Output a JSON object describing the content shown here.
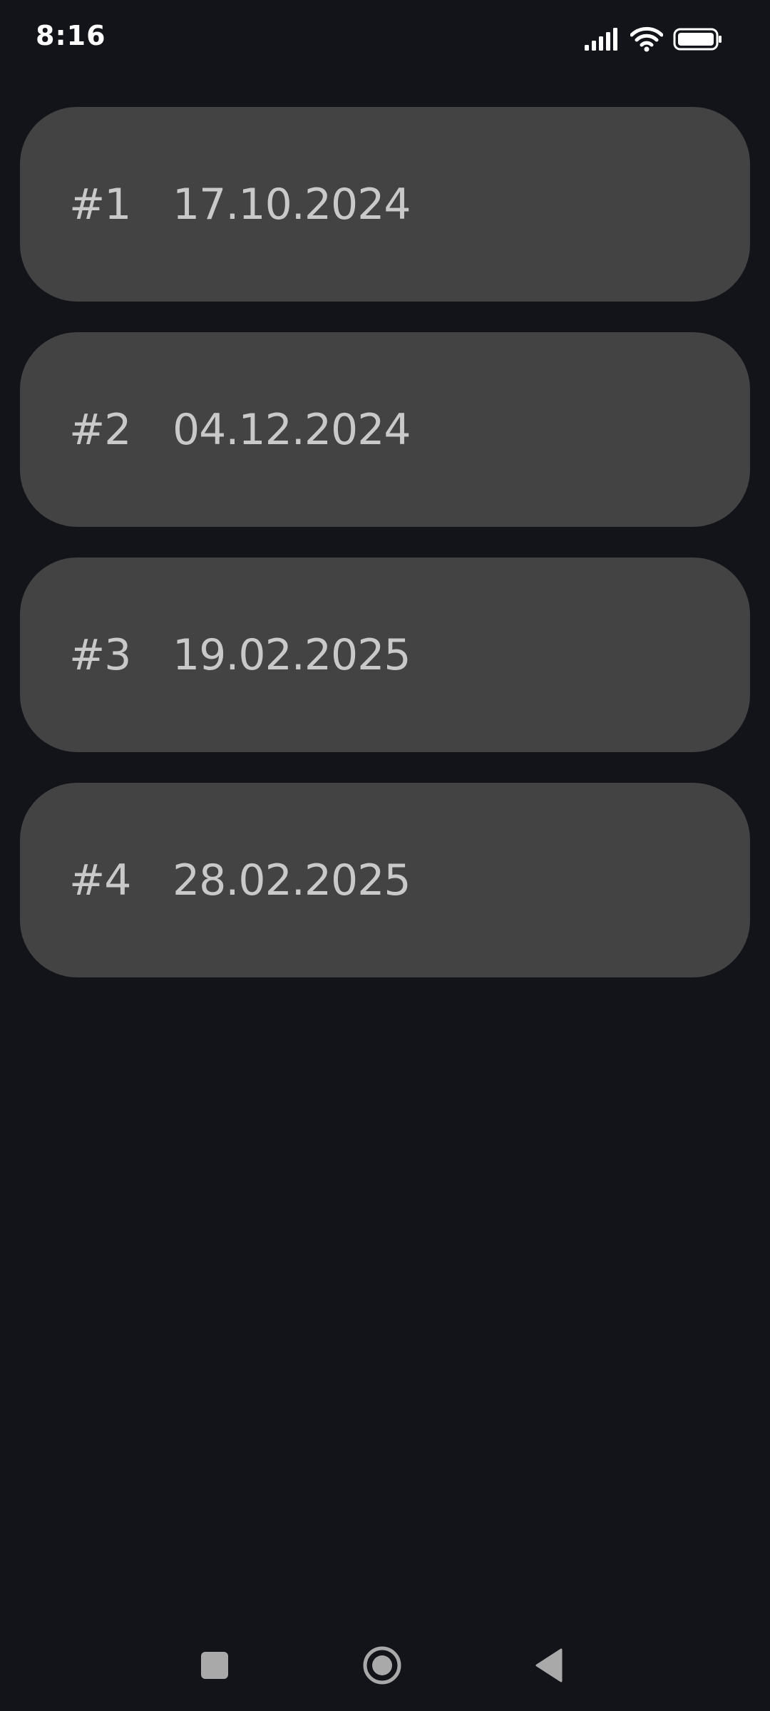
{
  "status_bar": {
    "time": "8:16",
    "icons": [
      "signal-icon",
      "wifi-icon",
      "battery-icon"
    ]
  },
  "entries": [
    {
      "number": "#1",
      "date": "17.10.2024"
    },
    {
      "number": "#2",
      "date": "04.12.2024"
    },
    {
      "number": "#3",
      "date": "19.02.2025"
    },
    {
      "number": "#4",
      "date": "28.02.2025"
    }
  ],
  "nav_bar": {
    "icons": [
      "recents-icon",
      "home-icon",
      "back-icon"
    ]
  },
  "colors": {
    "background": "#131419",
    "card": "#434343",
    "text": "#c9c9c9",
    "nav_icon": "#a9a9a9"
  }
}
